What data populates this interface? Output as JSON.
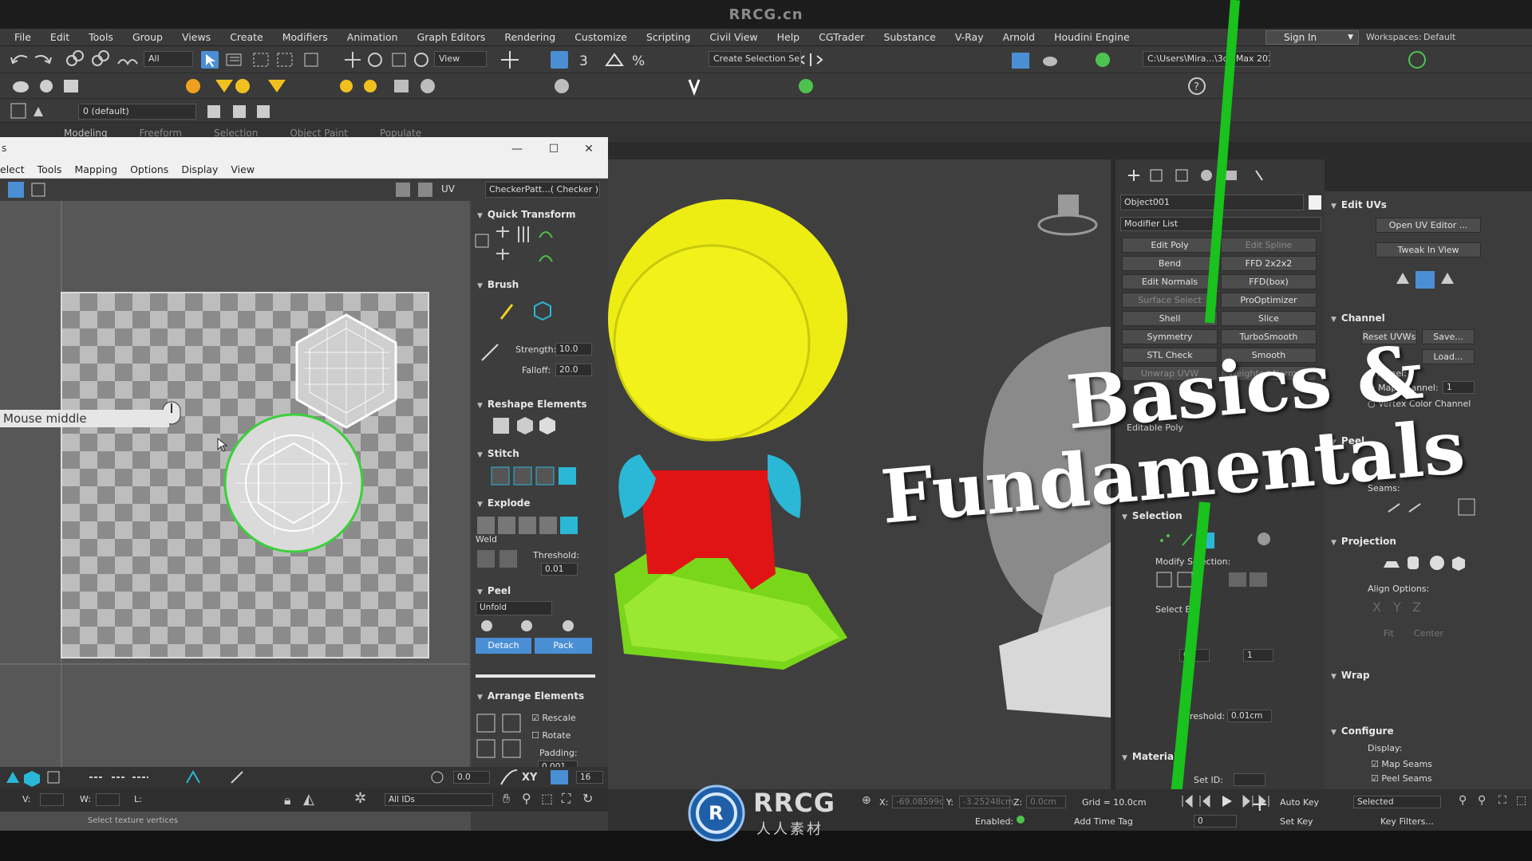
{
  "app": {
    "title": "RRCG.cn"
  },
  "menubar": {
    "items": [
      "File",
      "Edit",
      "Tools",
      "Group",
      "Views",
      "Create",
      "Modifiers",
      "Animation",
      "Graph Editors",
      "Rendering",
      "Customize",
      "Scripting",
      "Civil View",
      "Help",
      "CGTrader",
      "Substance",
      "V-Ray",
      "Arnold",
      "Houdini Engine"
    ],
    "sign_in": "Sign In",
    "workspaces_label": "Workspaces:",
    "workspaces_value": "Default"
  },
  "toolbar": {
    "filter_all": "All",
    "view_dd": "View",
    "create_selection": "Create Selection Se",
    "path": "C:\\Users\\Mira...\\3ds Max 202",
    "layer_dd": "0 (default)"
  },
  "ribbon_tabs": [
    "Modeling",
    "Freeform",
    "Selection",
    "Object Paint",
    "Populate"
  ],
  "uv_editor": {
    "title": "s",
    "menu": [
      "elect",
      "Tools",
      "Mapping",
      "Options",
      "Display",
      "View"
    ],
    "uv_label": "UV",
    "checker_dd": "CheckerPatt...( Checker )",
    "tooltip": "Mouse middle",
    "quick_transform": "Quick Transform",
    "brush": "Brush",
    "strength_label": "Strength:",
    "strength_value": "10.0",
    "falloff_label": "Falloff:",
    "falloff_value": "20.0",
    "reshape": "Reshape Elements",
    "stitch": "Stitch",
    "explode": "Explode",
    "weld_label": "Weld",
    "threshold_label": "Threshold:",
    "threshold_value": "0.01",
    "peel": "Peel",
    "unfold_dd": "Unfold",
    "detach": "Detach",
    "pack": "Pack",
    "arrange": "Arrange Elements",
    "rescale": "Rescale",
    "rotate": "Rotate",
    "padding_label": "Padding:",
    "padding_value": "0.001",
    "bottom_value": "0.0",
    "bottom_xy": "XY",
    "bottom_16": "16",
    "v_label": "V:",
    "w_label": "W:",
    "l_label": "L:",
    "all_ids": "All IDs",
    "status_text": "Select texture vertices"
  },
  "command_panel": {
    "object_name": "Object001",
    "modifier_list": "Modifier List",
    "modifier_buttons": [
      [
        "Edit Poly",
        "Edit Spline"
      ],
      [
        "Bend",
        "FFD 2x2x2"
      ],
      [
        "Edit Normals",
        "FFD(box)"
      ],
      [
        "Surface Select",
        "ProOptimizer"
      ],
      [
        "Shell",
        "Slice"
      ],
      [
        "Symmetry",
        "TurboSmooth"
      ],
      [
        "STL Check",
        "Smooth"
      ],
      [
        "Unwrap UVW",
        "Weighted Normals"
      ]
    ],
    "editable_poly": "Editable Poly",
    "selection_title": "Selection",
    "modify_selection": "Modify Selection:",
    "select_by": "Select B",
    "threshold_label": "hreshold:",
    "threshold_value": "0.01cm",
    "material_ids": "Material I",
    "set_id": "Set ID:",
    "spin_value_a": "0",
    "spin_value_b": "1"
  },
  "right_panel": {
    "edit_uvs": "Edit UVs",
    "open_uv_editor": "Open UV Editor ...",
    "tweak_in_view": "Tweak In View",
    "channel": "Channel",
    "reset_uvws": "Reset UVWs",
    "save": "Save...",
    "load": "Load...",
    "channel_label": "Channel:",
    "map_channel": "Map Channel:",
    "map_channel_value": "1",
    "vertex_color_channel": "Vertex Color Channel",
    "peel": "Peel",
    "seams": "Seams:",
    "projection": "Projection",
    "align_options": "Align Options:",
    "axes": [
      "X",
      "Y",
      "Z"
    ],
    "fit": "Fit",
    "center": "Center",
    "wrap": "Wrap",
    "configure": "Configure",
    "display": "Display:",
    "map_seams": "Map Seams",
    "peel_seams": "Peel Seams"
  },
  "bottom": {
    "x_label": "X:",
    "x_value": "-69.08599c",
    "y_label": "Y:",
    "y_value": "-3.25248cm",
    "z_label": "Z:",
    "z_value": "0.0cm",
    "grid": "Grid = 10.0cm",
    "enabled": "Enabled:",
    "add_time_tag": "Add Time Tag",
    "auto_key": "Auto Key",
    "selected": "Selected",
    "set_key": "Set Key",
    "key_filters": "Key Filters...",
    "frame_value": "0"
  },
  "overlay": {
    "line1": "Basics &",
    "line2": "Fundamentals"
  },
  "watermark": {
    "main": "RRCG",
    "sub": "人人素材"
  },
  "colors": {
    "accent_blue": "#4a8fd4",
    "green_stroke": "#19c21c",
    "head_yellow": "#ecec12",
    "body_red": "#e01313",
    "arms_cyan": "#2bb7d6",
    "base_green": "#8fe81f"
  }
}
